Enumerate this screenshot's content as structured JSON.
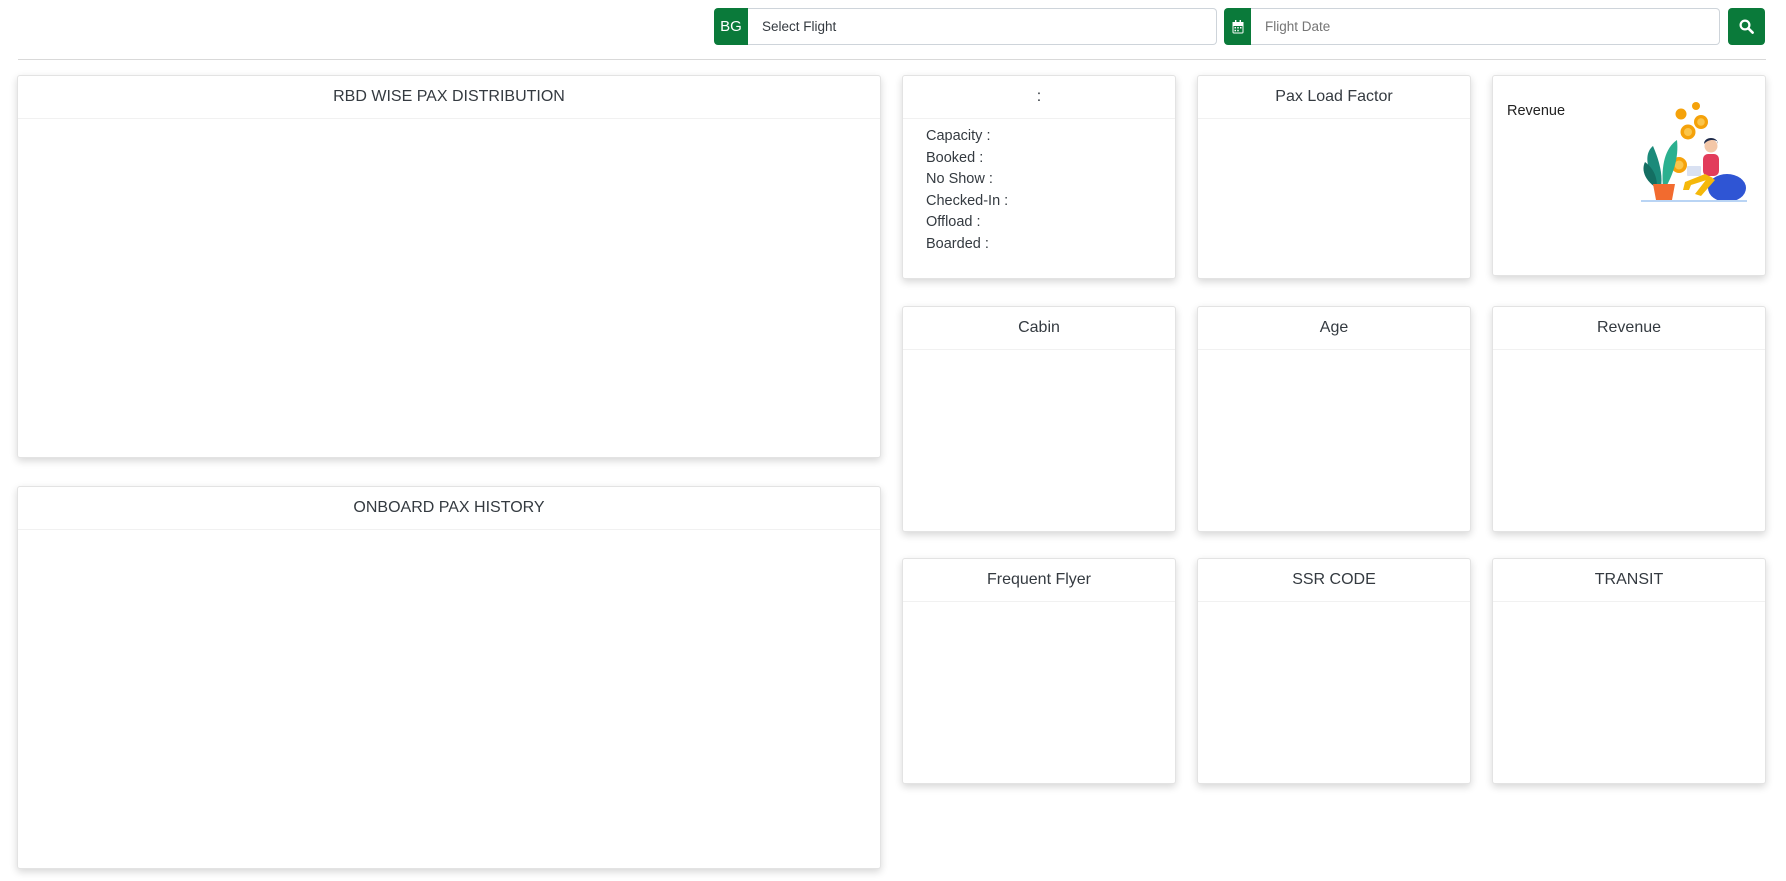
{
  "header": {
    "airline_code": "BG",
    "flight_select": {
      "value": "Select Flight"
    },
    "flight_date": {
      "placeholder": "Flight Date"
    },
    "search_icon": "search-icon",
    "calendar_icon": "calendar-icon"
  },
  "colors": {
    "accent": "#0a7a3a"
  },
  "panels": {
    "rbd": {
      "title": "RBD WISE PAX DISTRIBUTION"
    },
    "onboard": {
      "title": "ONBOARD PAX HISTORY"
    },
    "summary": {
      "title": ":",
      "rows": [
        "Capacity :",
        "Booked :",
        "No Show :",
        "Checked-In :",
        "Offload :",
        "Boarded :"
      ]
    },
    "load_factor": {
      "title": "Pax Load Factor"
    },
    "revenue_card": {
      "label": "Revenue"
    },
    "cabin": {
      "title": "Cabin"
    },
    "age": {
      "title": "Age"
    },
    "revenue": {
      "title": "Revenue"
    },
    "frequent_flyer": {
      "title": "Frequent Flyer"
    },
    "ssr": {
      "title": "SSR CODE"
    },
    "transit": {
      "title": "TRANSIT"
    }
  }
}
